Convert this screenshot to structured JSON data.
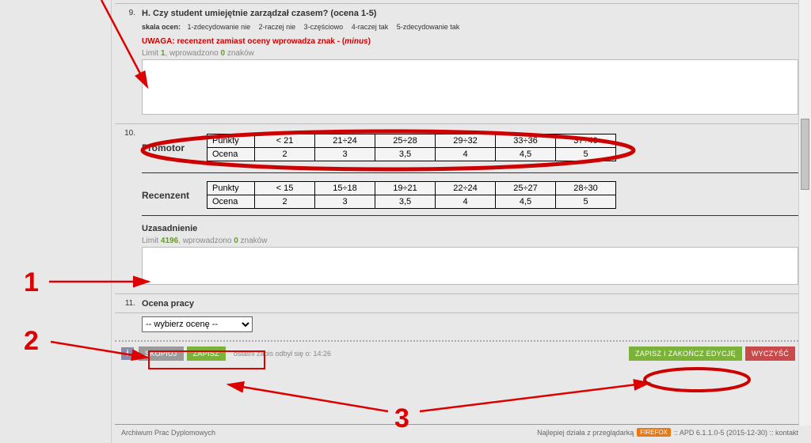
{
  "q9": {
    "num": "9.",
    "title": "H. Czy student umiejętnie zarządzał czasem? (ocena 1-5)",
    "scale_label": "skala ocen:",
    "scale_items": [
      "1-zdecydowanie nie",
      "2-raczej nie",
      "3-częściowo",
      "4-raczej tak",
      "5-zdecydowanie tak"
    ],
    "warning_pre": "UWAGA: recenzent zamiast oceny wprowadza znak - (",
    "warning_it": "minus",
    "warning_post": ")",
    "limit_pre": "Limit ",
    "limit_n1": "1",
    "limit_mid": ", wprowadzono ",
    "limit_n2": "0",
    "limit_post": " znaków"
  },
  "q10_num": "10.",
  "promotor": {
    "label": "Promotor",
    "row1_head": "Punkty",
    "row1": [
      "< 21",
      "21÷24",
      "25÷28",
      "29÷32",
      "33÷36",
      "37÷40"
    ],
    "row2_head": "Ocena",
    "row2": [
      "2",
      "3",
      "3,5",
      "4",
      "4,5",
      "5"
    ]
  },
  "recenzent": {
    "label": "Recenzent",
    "row1_head": "Punkty",
    "row1": [
      "< 15",
      "15÷18",
      "19÷21",
      "22÷24",
      "25÷27",
      "28÷30"
    ],
    "row2_head": "Ocena",
    "row2": [
      "2",
      "3",
      "3,5",
      "4",
      "4,5",
      "5"
    ]
  },
  "uz": {
    "title": "Uzasadnienie",
    "limit_pre": "Limit ",
    "limit_n1": "4196",
    "limit_mid": ", wprowadzono ",
    "limit_n2": "0",
    "limit_post": " znaków"
  },
  "q11": {
    "num": "11.",
    "title": "Ocena pracy"
  },
  "select": {
    "placeholder": "-- wybierz ocenę --"
  },
  "actions": {
    "kopiuj": "SKOPIUJ",
    "zapisz": "ZAPISZ",
    "note": "ostatni zapis odbył się o: 14:26",
    "zapisz_zakoncz": "ZAPISZ I ZAKOŃCZ EDYCJĘ",
    "wyczysc": "WYCZYŚĆ"
  },
  "footer": {
    "left": "Archiwum Prac Dyplomowych",
    "right_pre": "Najlepiej działa z przeglądarką",
    "ff": "FIREFOX",
    "right_post": ":: APD 6.1.1.0-5 (2015-12-30) :: kontakt"
  },
  "annotations": {
    "n1": "1",
    "n2": "2",
    "n3": "3"
  }
}
